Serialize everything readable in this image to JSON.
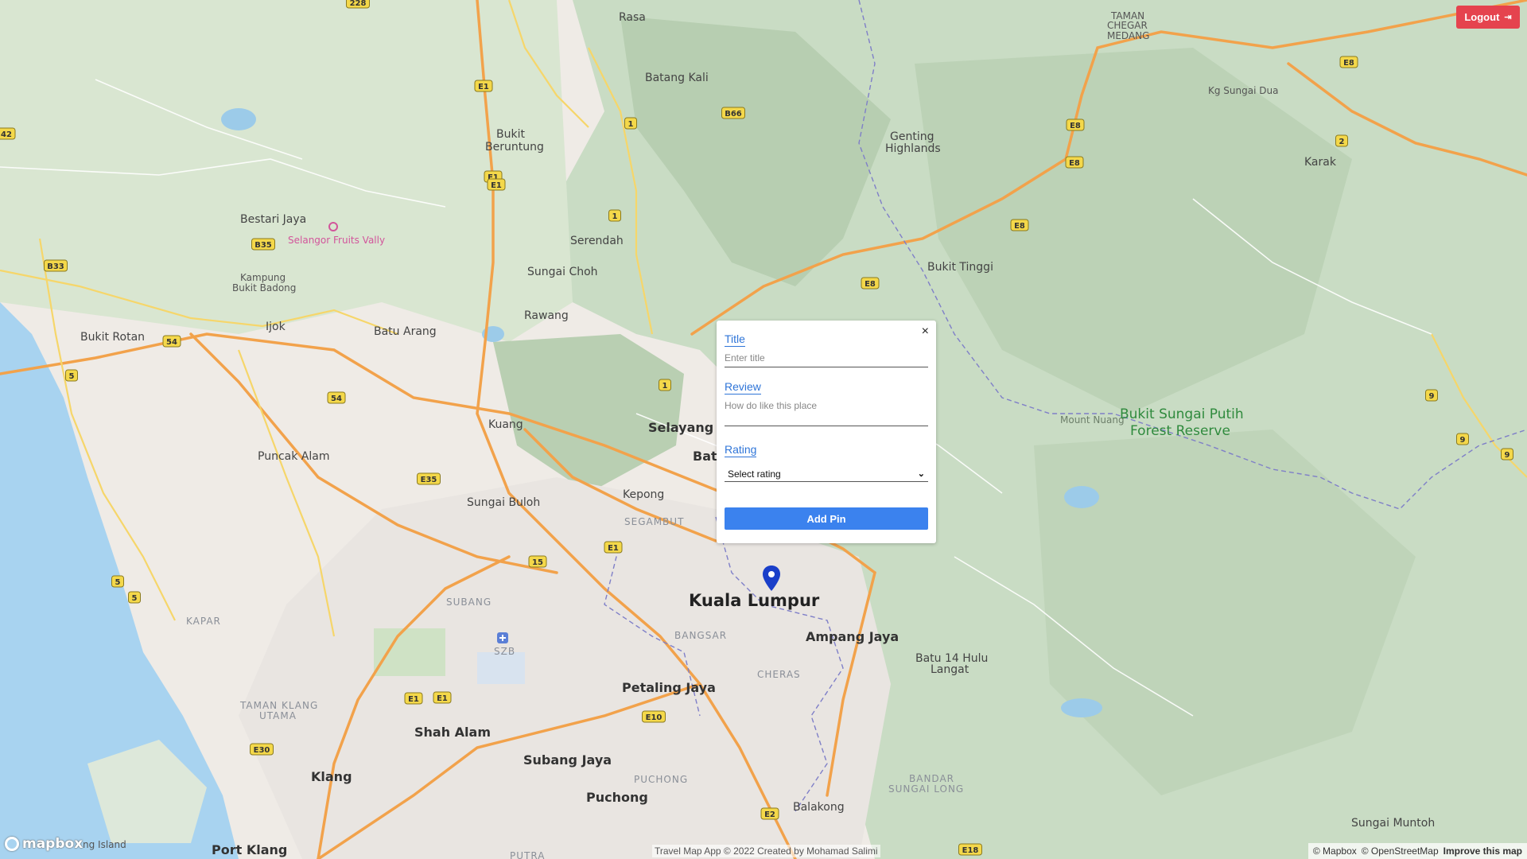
{
  "header": {
    "logout_label": "Logout",
    "logout_icon": "sign-out-icon"
  },
  "popup": {
    "close_glyph": "×",
    "title_label": "Title",
    "title_placeholder": "Enter title",
    "review_label": "Review",
    "review_placeholder": "How do like this place",
    "rating_label": "Rating",
    "rating_selected": "Select rating",
    "submit_label": "Add Pin"
  },
  "footer": {
    "credit": "Travel Map App © 2022 Created by Mohamad Salimi"
  },
  "attribution": {
    "mapbox": "© Mapbox",
    "osm": "© OpenStreetMap",
    "improve": "Improve this map",
    "logo": "mapbox"
  },
  "map": {
    "pin_color": "#1a3fc9",
    "places": {
      "kuala_lumpur": "Kuala Lumpur",
      "shah_alam": "Shah Alam",
      "klang": "Klang",
      "port_klang": "Port Klang",
      "petaling_jaya": "Petaling Jaya",
      "subang_jaya": "Subang Jaya",
      "puchong": "Puchong",
      "ampang_jaya": "Ampang Jaya",
      "selayang": "Selayang",
      "batu": "Batu",
      "kepong": "Kepong",
      "sungai_buloh": "Sungai Buloh",
      "kuang": "Kuang",
      "puncak_alam": "Puncak Alam",
      "rawang": "Rawang",
      "batu_arang": "Batu Arang",
      "ijok": "Ijok",
      "bukit_rotan": "Bukit Rotan",
      "bestari_jaya": "Bestari Jaya",
      "kampung_bukit_badong_1": "Kampung",
      "kampung_bukit_badong_2": "Bukit Badong",
      "sungai_choh": "Sungai Choh",
      "serendah": "Serendah",
      "bukit_beruntung_1": "Bukit",
      "bukit_beruntung_2": "Beruntung",
      "batang_kali": "Batang Kali",
      "rasa": "Rasa",
      "genting_1": "Genting",
      "genting_2": "Highlands",
      "bukit_tinggi": "Bukit Tinggi",
      "kg_sungai_dua": "Kg Sungai Dua",
      "karak": "Karak",
      "taman_chegar_1": "TAMAN",
      "taman_chegar_2": "CHEGAR",
      "taman_chegar_3": "MEDANG",
      "mount_nuang": "Mount Nuang",
      "forest_1": "Bukit Sungai Putih",
      "forest_2": "Forest Reserve",
      "batu14_1": "Batu 14 Hulu",
      "batu14_2": "Langat",
      "balakong": "Balakong",
      "sungai_muntoh": "Sungai Muntoh",
      "segambut": "SEGAMBUT",
      "bangsar": "BANGSAR",
      "cheras": "CHERAS",
      "subang": "SUBANG",
      "kapar": "KAPAR",
      "taman_klang_utama_1": "TAMAN KLANG",
      "taman_klang_utama_2": "UTAMA",
      "pu_chong": "PUCHONG",
      "bandar_sl_1": "BANDAR",
      "bandar_sl_2": "SUNGAI LONG",
      "putra": "PUTRA",
      "szb": "SZB",
      "fruits_valley": "Selangor Fruits Vallу",
      "island": "ng Island"
    },
    "shields": [
      "228",
      "E1",
      "E1",
      "1",
      "B66",
      "1",
      "E1",
      "B35",
      "B33",
      "54",
      "5",
      "54",
      "1",
      "E35",
      "15",
      "E1",
      "5",
      "5",
      "E1",
      "E1",
      "E30",
      "E10",
      "E2",
      "E18",
      "E8",
      "E8",
      "E8",
      "E8",
      "E8",
      "2",
      "9",
      "9",
      "9",
      "42"
    ]
  }
}
